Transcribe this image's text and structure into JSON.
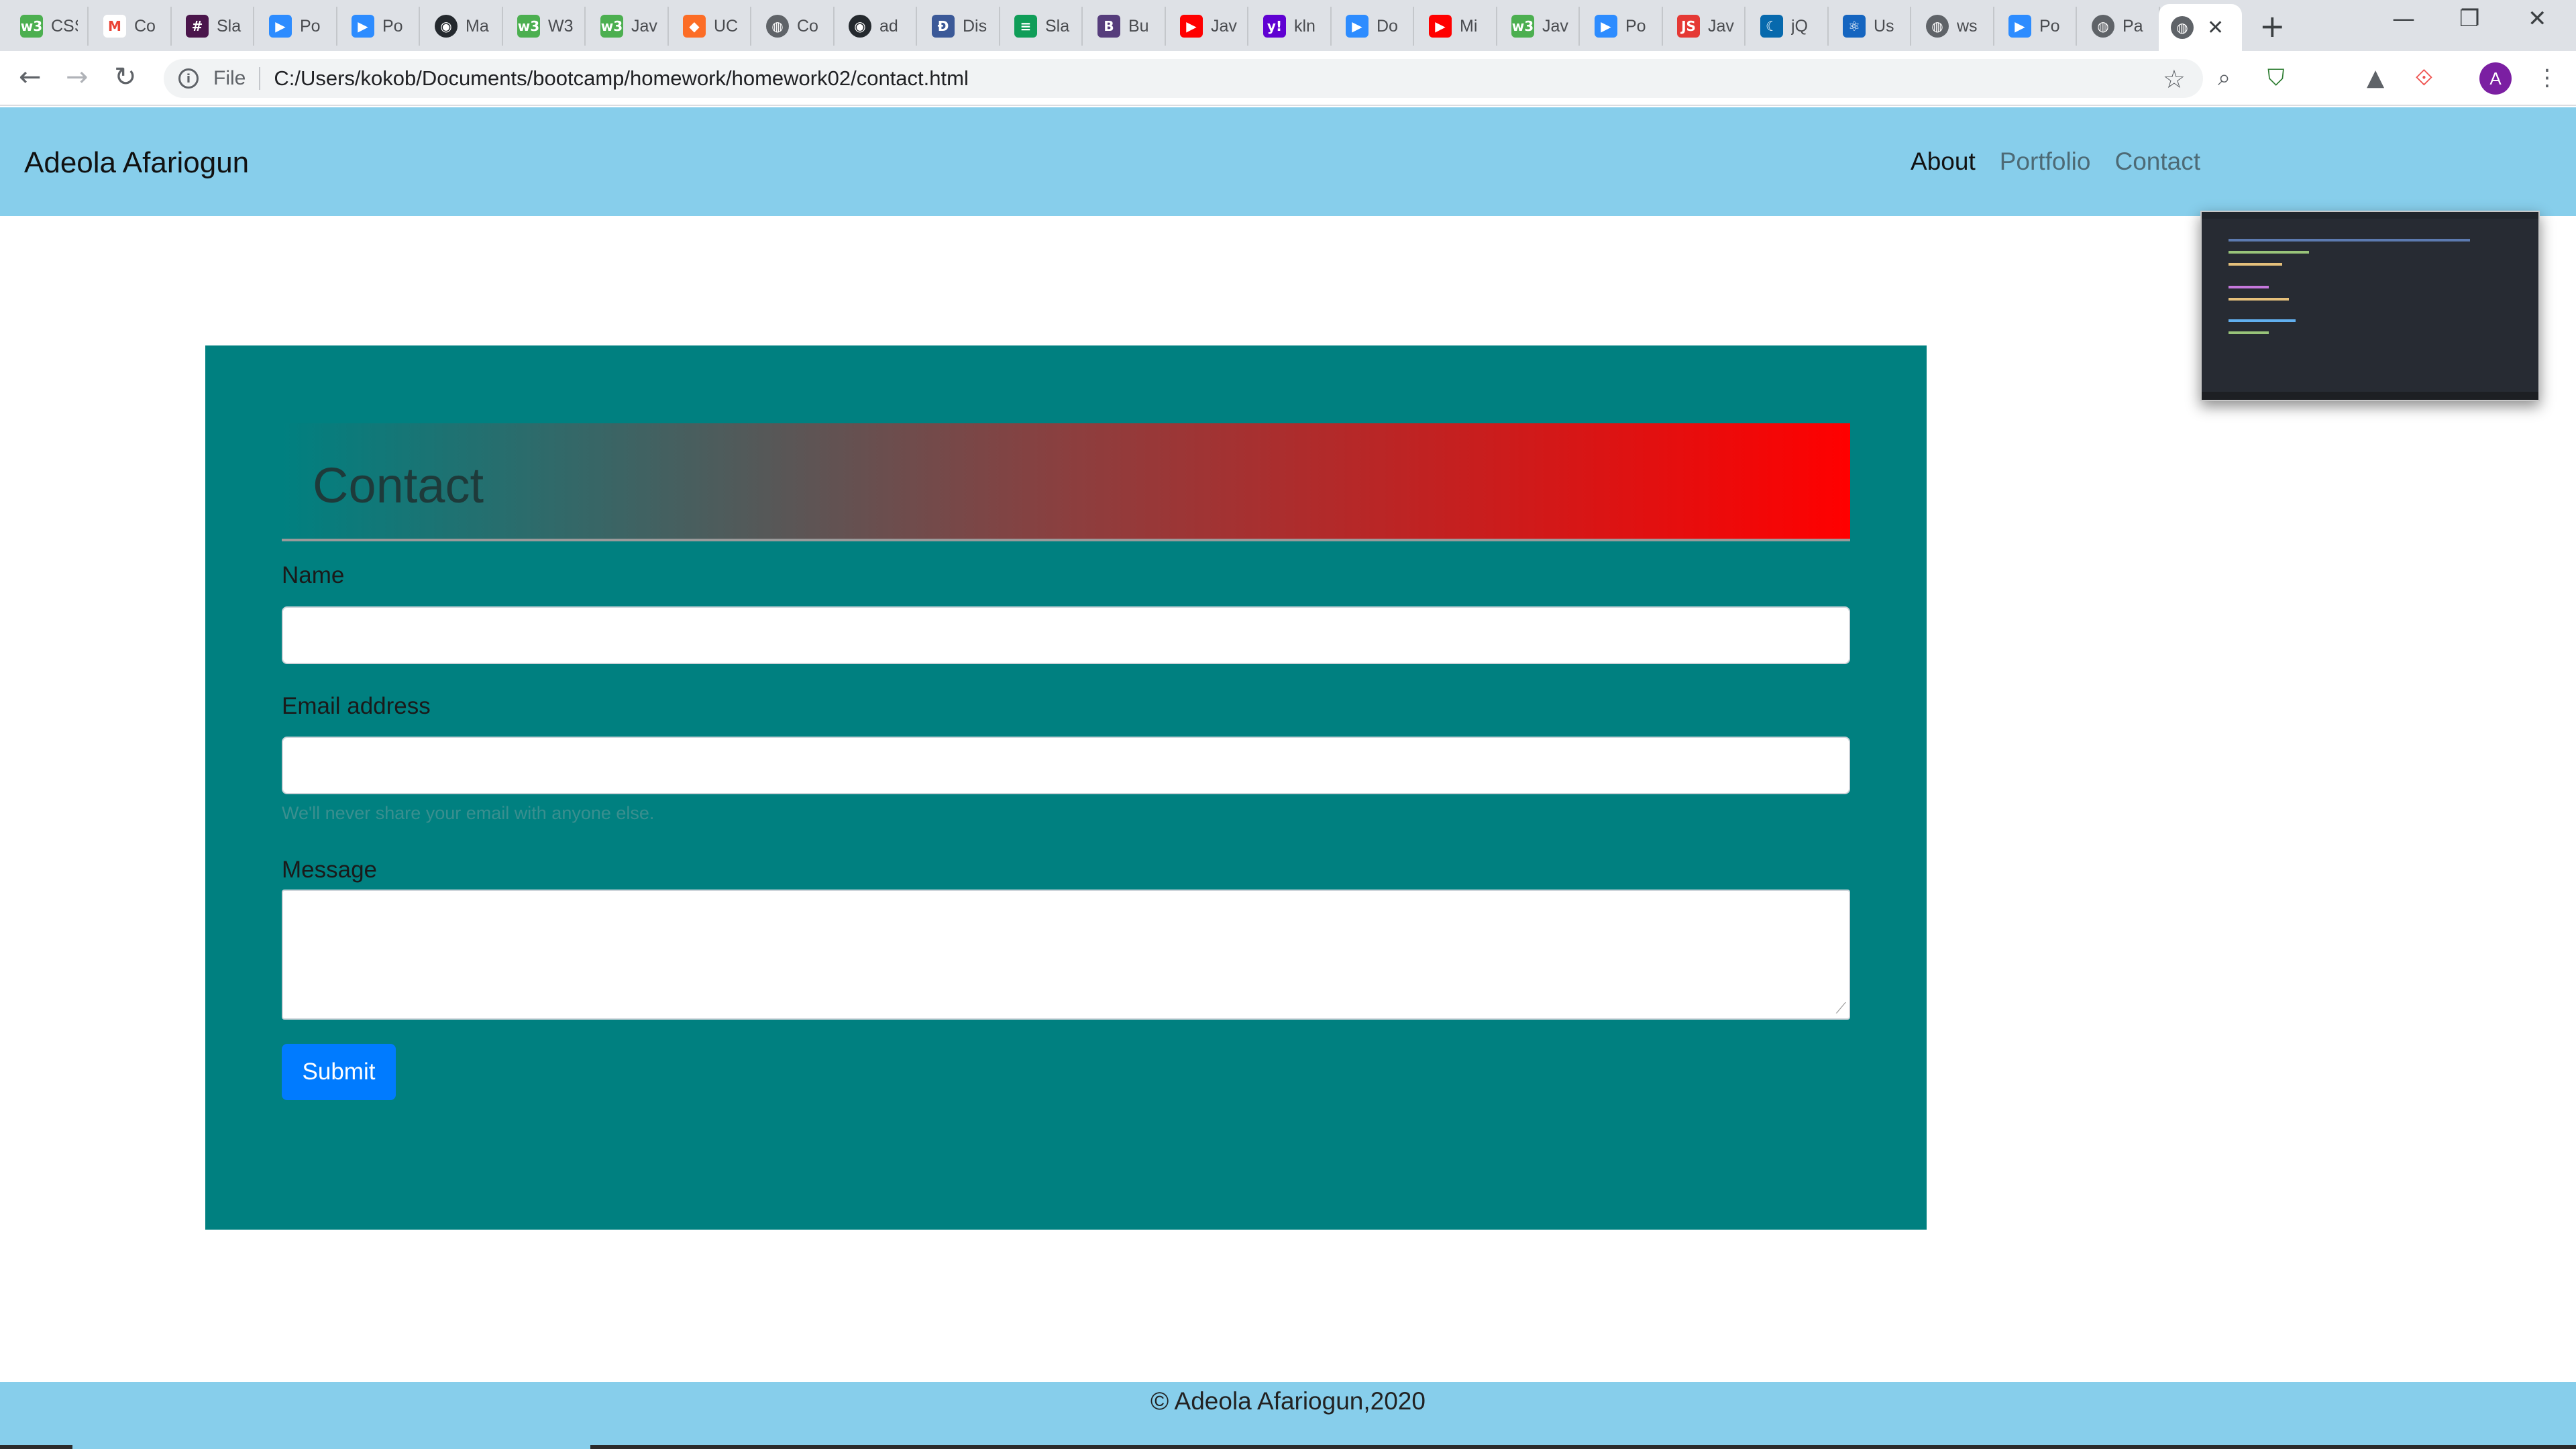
{
  "browser": {
    "tabs": [
      {
        "label": "CSS",
        "icon": "w3schools-icon",
        "color": "#4caf50"
      },
      {
        "label": "Co",
        "icon": "gmail-icon",
        "color": "#ea4335"
      },
      {
        "label": "Sla",
        "icon": "slack-icon",
        "color": "#4a154b"
      },
      {
        "label": "Po",
        "icon": "zoom-icon",
        "color": "#2d8cff"
      },
      {
        "label": "Po",
        "icon": "zoom-icon",
        "color": "#2d8cff"
      },
      {
        "label": "Ma",
        "icon": "github-icon",
        "color": "#24292e"
      },
      {
        "label": "W3",
        "icon": "w3schools-icon",
        "color": "#4caf50"
      },
      {
        "label": "Jav",
        "icon": "w3schools-icon",
        "color": "#4caf50"
      },
      {
        "label": "UC",
        "icon": "gitlab-icon",
        "color": "#fc6d26"
      },
      {
        "label": "Co",
        "icon": "globe-icon",
        "color": "#5f6368"
      },
      {
        "label": "ad",
        "icon": "github-icon",
        "color": "#24292e"
      },
      {
        "label": "Dis",
        "icon": "discovery-icon",
        "color": "#3b5998"
      },
      {
        "label": "Sla",
        "icon": "sheets-icon",
        "color": "#0f9d58"
      },
      {
        "label": "Bu",
        "icon": "bootstrap-icon",
        "color": "#563d7c"
      },
      {
        "label": "Jav",
        "icon": "youtube-icon",
        "color": "#ff0000"
      },
      {
        "label": "kln",
        "icon": "yahoo-icon",
        "color": "#6001d2"
      },
      {
        "label": "Do",
        "icon": "zoom-icon",
        "color": "#2d8cff"
      },
      {
        "label": "Mi",
        "icon": "youtube-icon",
        "color": "#ff0000"
      },
      {
        "label": "Jav",
        "icon": "w3schools-icon",
        "color": "#4caf50"
      },
      {
        "label": "Po",
        "icon": "zoom-icon",
        "color": "#2d8cff"
      },
      {
        "label": "Jav",
        "icon": "javascript-icon",
        "color": "#e53935"
      },
      {
        "label": "jQ",
        "icon": "jquery-icon",
        "color": "#0769ad"
      },
      {
        "label": "Us",
        "icon": "react-icon",
        "color": "#1565c0"
      },
      {
        "label": "ws",
        "icon": "globe-icon",
        "color": "#5f6368"
      },
      {
        "label": "Po",
        "icon": "zoom-icon",
        "color": "#2d8cff"
      },
      {
        "label": "Pa",
        "icon": "globe-icon",
        "color": "#5f6368"
      }
    ],
    "active_tab_icon": "globe-icon",
    "file_label": "File",
    "url": "C:/Users/kokob/Documents/bootcamp/homework/homework02/contact.html",
    "profile_initial": "A"
  },
  "navbar": {
    "brand": "Adeola Afariogun",
    "links": [
      "About",
      "Portfolio",
      "Contact"
    ]
  },
  "form": {
    "heading": "Contact",
    "name_label": "Name",
    "email_label": "Email address",
    "email_help": "We'll never share your email with anyone else.",
    "message_label": "Message",
    "submit_label": "Submit"
  },
  "footer": {
    "text": "© Adeola Afariogun,2020"
  },
  "colors": {
    "navbar_bg": "#87ceeb",
    "card_bg": "#008080",
    "gradient_end": "#ff0000",
    "submit_bg": "#007bff"
  }
}
